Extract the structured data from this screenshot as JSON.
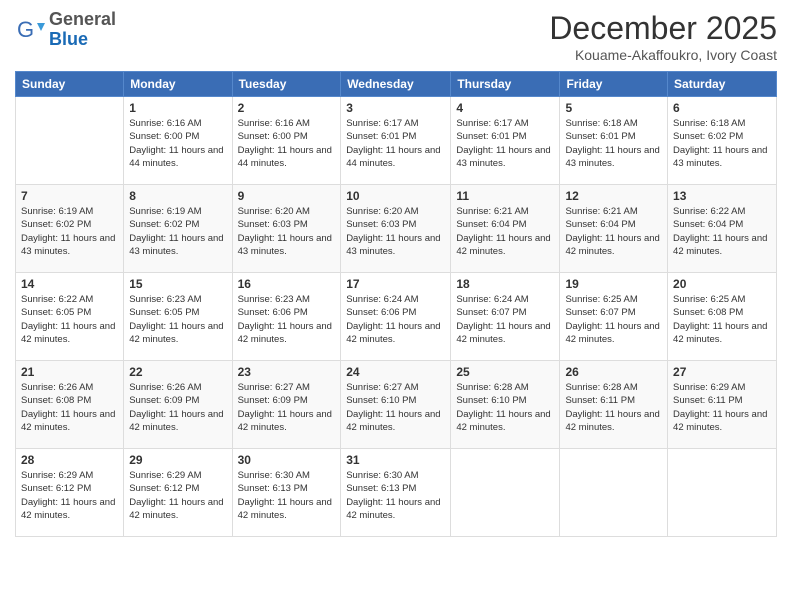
{
  "logo": {
    "general": "General",
    "blue": "Blue"
  },
  "header": {
    "month": "December 2025",
    "location": "Kouame-Akaffoukro, Ivory Coast"
  },
  "days_of_week": [
    "Sunday",
    "Monday",
    "Tuesday",
    "Wednesday",
    "Thursday",
    "Friday",
    "Saturday"
  ],
  "weeks": [
    [
      {
        "num": "",
        "info": ""
      },
      {
        "num": "1",
        "info": "Sunrise: 6:16 AM\nSunset: 6:00 PM\nDaylight: 11 hours\nand 44 minutes."
      },
      {
        "num": "2",
        "info": "Sunrise: 6:16 AM\nSunset: 6:00 PM\nDaylight: 11 hours\nand 44 minutes."
      },
      {
        "num": "3",
        "info": "Sunrise: 6:17 AM\nSunset: 6:01 PM\nDaylight: 11 hours\nand 44 minutes."
      },
      {
        "num": "4",
        "info": "Sunrise: 6:17 AM\nSunset: 6:01 PM\nDaylight: 11 hours\nand 43 minutes."
      },
      {
        "num": "5",
        "info": "Sunrise: 6:18 AM\nSunset: 6:01 PM\nDaylight: 11 hours\nand 43 minutes."
      },
      {
        "num": "6",
        "info": "Sunrise: 6:18 AM\nSunset: 6:02 PM\nDaylight: 11 hours\nand 43 minutes."
      }
    ],
    [
      {
        "num": "7",
        "info": "Sunrise: 6:19 AM\nSunset: 6:02 PM\nDaylight: 11 hours\nand 43 minutes."
      },
      {
        "num": "8",
        "info": "Sunrise: 6:19 AM\nSunset: 6:02 PM\nDaylight: 11 hours\nand 43 minutes."
      },
      {
        "num": "9",
        "info": "Sunrise: 6:20 AM\nSunset: 6:03 PM\nDaylight: 11 hours\nand 43 minutes."
      },
      {
        "num": "10",
        "info": "Sunrise: 6:20 AM\nSunset: 6:03 PM\nDaylight: 11 hours\nand 43 minutes."
      },
      {
        "num": "11",
        "info": "Sunrise: 6:21 AM\nSunset: 6:04 PM\nDaylight: 11 hours\nand 42 minutes."
      },
      {
        "num": "12",
        "info": "Sunrise: 6:21 AM\nSunset: 6:04 PM\nDaylight: 11 hours\nand 42 minutes."
      },
      {
        "num": "13",
        "info": "Sunrise: 6:22 AM\nSunset: 6:04 PM\nDaylight: 11 hours\nand 42 minutes."
      }
    ],
    [
      {
        "num": "14",
        "info": "Sunrise: 6:22 AM\nSunset: 6:05 PM\nDaylight: 11 hours\nand 42 minutes."
      },
      {
        "num": "15",
        "info": "Sunrise: 6:23 AM\nSunset: 6:05 PM\nDaylight: 11 hours\nand 42 minutes."
      },
      {
        "num": "16",
        "info": "Sunrise: 6:23 AM\nSunset: 6:06 PM\nDaylight: 11 hours\nand 42 minutes."
      },
      {
        "num": "17",
        "info": "Sunrise: 6:24 AM\nSunset: 6:06 PM\nDaylight: 11 hours\nand 42 minutes."
      },
      {
        "num": "18",
        "info": "Sunrise: 6:24 AM\nSunset: 6:07 PM\nDaylight: 11 hours\nand 42 minutes."
      },
      {
        "num": "19",
        "info": "Sunrise: 6:25 AM\nSunset: 6:07 PM\nDaylight: 11 hours\nand 42 minutes."
      },
      {
        "num": "20",
        "info": "Sunrise: 6:25 AM\nSunset: 6:08 PM\nDaylight: 11 hours\nand 42 minutes."
      }
    ],
    [
      {
        "num": "21",
        "info": "Sunrise: 6:26 AM\nSunset: 6:08 PM\nDaylight: 11 hours\nand 42 minutes."
      },
      {
        "num": "22",
        "info": "Sunrise: 6:26 AM\nSunset: 6:09 PM\nDaylight: 11 hours\nand 42 minutes."
      },
      {
        "num": "23",
        "info": "Sunrise: 6:27 AM\nSunset: 6:09 PM\nDaylight: 11 hours\nand 42 minutes."
      },
      {
        "num": "24",
        "info": "Sunrise: 6:27 AM\nSunset: 6:10 PM\nDaylight: 11 hours\nand 42 minutes."
      },
      {
        "num": "25",
        "info": "Sunrise: 6:28 AM\nSunset: 6:10 PM\nDaylight: 11 hours\nand 42 minutes."
      },
      {
        "num": "26",
        "info": "Sunrise: 6:28 AM\nSunset: 6:11 PM\nDaylight: 11 hours\nand 42 minutes."
      },
      {
        "num": "27",
        "info": "Sunrise: 6:29 AM\nSunset: 6:11 PM\nDaylight: 11 hours\nand 42 minutes."
      }
    ],
    [
      {
        "num": "28",
        "info": "Sunrise: 6:29 AM\nSunset: 6:12 PM\nDaylight: 11 hours\nand 42 minutes."
      },
      {
        "num": "29",
        "info": "Sunrise: 6:29 AM\nSunset: 6:12 PM\nDaylight: 11 hours\nand 42 minutes."
      },
      {
        "num": "30",
        "info": "Sunrise: 6:30 AM\nSunset: 6:13 PM\nDaylight: 11 hours\nand 42 minutes."
      },
      {
        "num": "31",
        "info": "Sunrise: 6:30 AM\nSunset: 6:13 PM\nDaylight: 11 hours\nand 42 minutes."
      },
      {
        "num": "",
        "info": ""
      },
      {
        "num": "",
        "info": ""
      },
      {
        "num": "",
        "info": ""
      }
    ]
  ]
}
